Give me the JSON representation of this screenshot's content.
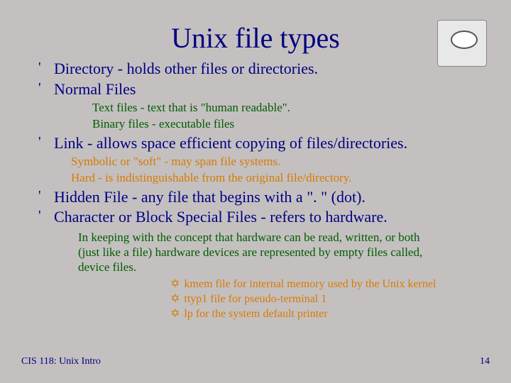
{
  "title": "Unix file types",
  "items": [
    {
      "text": "Directory - holds other files or directories."
    },
    {
      "text": "Normal Files"
    }
  ],
  "normal_sub": [
    "Text files - text that is \"human readable\".",
    "Binary files - executable files"
  ],
  "item_link": "Link - allows space efficient copying of files/directories.",
  "link_sub": [
    "Symbolic or \"soft\" - may span file systems.",
    "Hard - is indistinguishable from the original file/directory."
  ],
  "items2": [
    {
      "text": "Hidden File - any file that begins with a \". \" (dot)."
    },
    {
      "text": "Character or Block Special Files - refers to hardware."
    }
  ],
  "hw_para": "In keeping with the concept that hardware can be read, written, or both (just like a file) hardware devices are represented by empty files called, device files.",
  "hw_sub": [
    "kmem file for internal memory used by the Unix kernel",
    "ttyp1 file for pseudo-terminal 1",
    "lp for the system default printer"
  ],
  "footer": {
    "left": "CIS 118: Unix Intro",
    "right": "14"
  }
}
